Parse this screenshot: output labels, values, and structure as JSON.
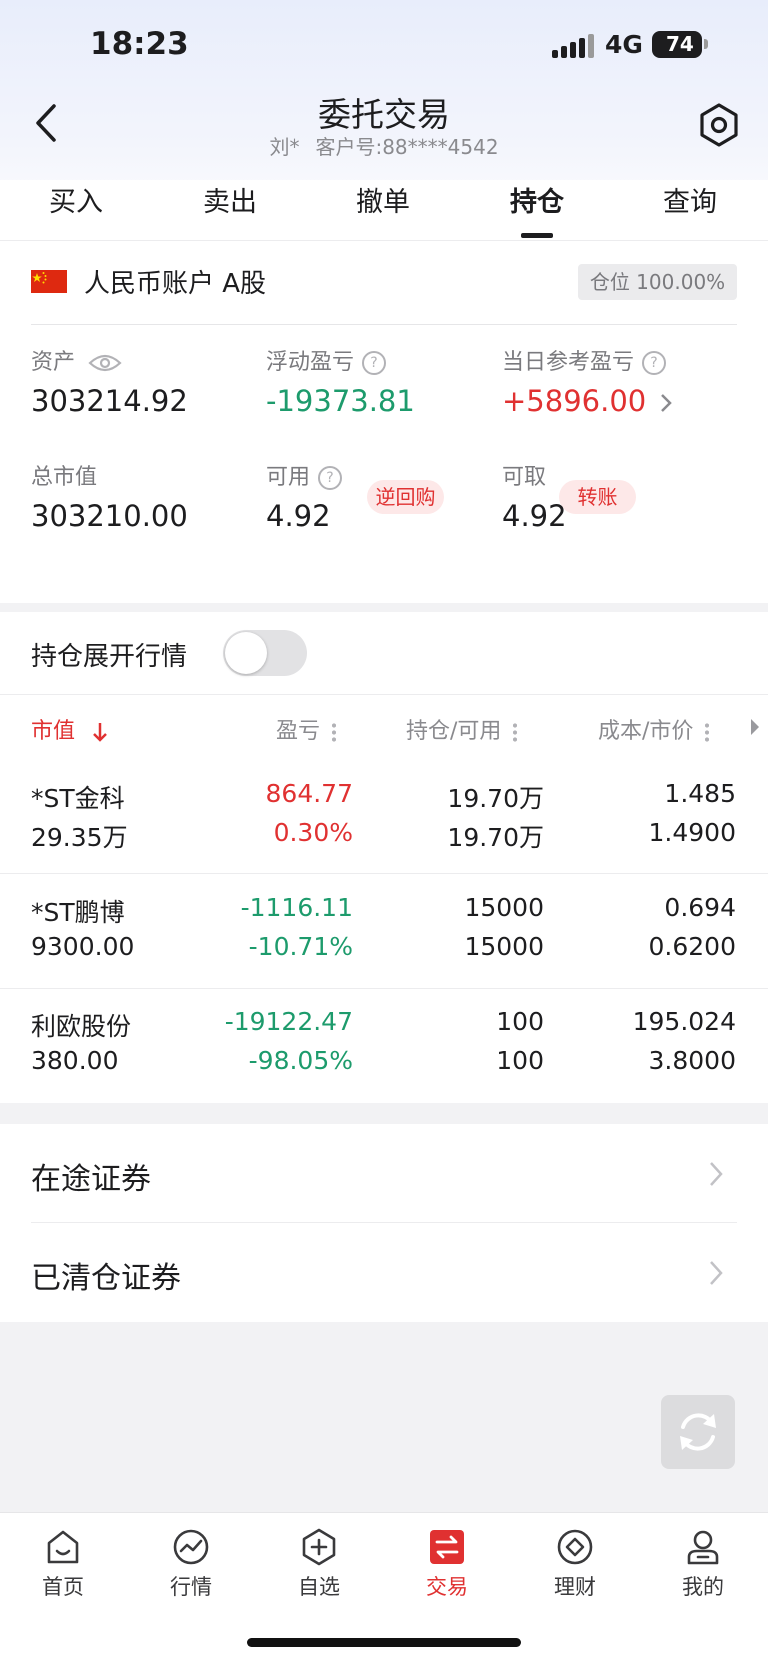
{
  "status_bar": {
    "time": "18:23",
    "network": "4G",
    "battery": "74"
  },
  "header": {
    "title": "委托交易",
    "user": "刘*",
    "customer_no": "客户号:88****4542"
  },
  "tabs": [
    {
      "label": "买入",
      "active": false
    },
    {
      "label": "卖出",
      "active": false
    },
    {
      "label": "撤单",
      "active": false
    },
    {
      "label": "持仓",
      "active": true
    },
    {
      "label": "查询",
      "active": false
    }
  ],
  "account": {
    "name": "人民币账户 A股",
    "position_badge": "仓位 100.00%",
    "assets_label": "资产",
    "assets_value": "303214.92",
    "float_pl_label": "浮动盈亏",
    "float_pl_value": "-19373.81",
    "day_pl_label": "当日参考盈亏",
    "day_pl_value": "+5896.00",
    "market_value_label": "总市值",
    "market_value": "303210.00",
    "available_label": "可用",
    "available_value": "4.92",
    "reverse_repo_label": "逆回购",
    "withdrawable_label": "可取",
    "withdrawable_value": "4.92",
    "transfer_label": "转账"
  },
  "toggle": {
    "label": "持仓展开行情",
    "on": false
  },
  "holdings": {
    "headers": {
      "market_value": "市值",
      "pl": "盈亏",
      "position": "持仓/可用",
      "cost": "成本/市价"
    },
    "rows": [
      {
        "name": "*ST金科",
        "market_value": "29.35万",
        "pl": "864.77",
        "pl_pct": "0.30%",
        "position": "19.70万",
        "available": "19.70万",
        "cost": "1.485",
        "price": "1.4900",
        "trend": "up"
      },
      {
        "name": "*ST鹏博",
        "market_value": "9300.00",
        "pl": "-1116.11",
        "pl_pct": "-10.71%",
        "position": "15000",
        "available": "15000",
        "cost": "0.694",
        "price": "0.6200",
        "trend": "down"
      },
      {
        "name": "利欧股份",
        "market_value": "380.00",
        "pl": "-19122.47",
        "pl_pct": "-98.05%",
        "position": "100",
        "available": "100",
        "cost": "195.024",
        "price": "3.8000",
        "trend": "down"
      }
    ]
  },
  "links": {
    "in_transit": "在途证券",
    "cleared": "已清仓证券"
  },
  "bottom_nav": [
    {
      "label": "首页",
      "icon": "home-icon",
      "active": false
    },
    {
      "label": "行情",
      "icon": "market-icon",
      "active": false
    },
    {
      "label": "自选",
      "icon": "watchlist-icon",
      "active": false
    },
    {
      "label": "交易",
      "icon": "trade-icon",
      "active": true
    },
    {
      "label": "理财",
      "icon": "wealth-icon",
      "active": false
    },
    {
      "label": "我的",
      "icon": "profile-icon",
      "active": false
    }
  ],
  "colors": {
    "up": "#e03131",
    "down": "#1d9b6c",
    "accent": "#e03131"
  }
}
